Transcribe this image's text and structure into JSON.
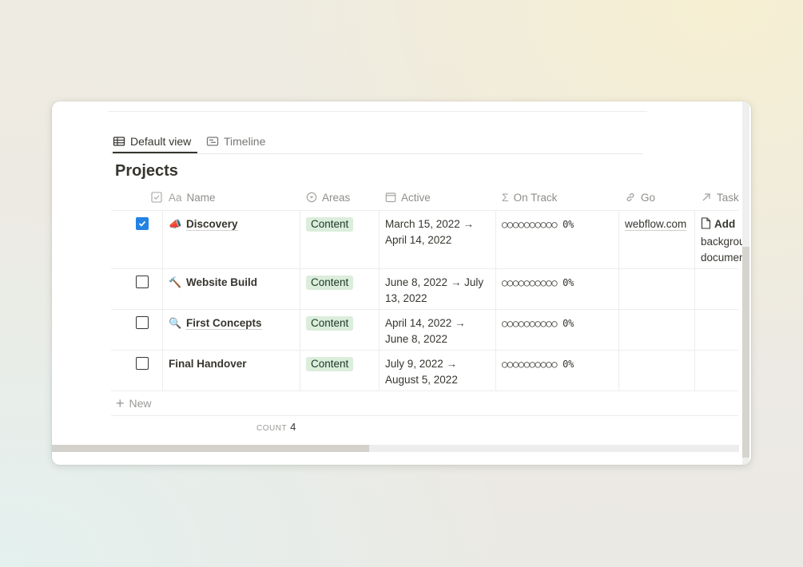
{
  "tabs": [
    {
      "label": "Default view",
      "icon": "table-icon"
    },
    {
      "label": "Timeline",
      "icon": "timeline-icon"
    }
  ],
  "database": {
    "title": "Projects"
  },
  "columns": {
    "check": {
      "icon": "checkbox-icon"
    },
    "name": {
      "label": "Name",
      "prefix": "Aa"
    },
    "areas": {
      "label": "Areas",
      "icon": "select-icon"
    },
    "active": {
      "label": "Active",
      "icon": "calendar-icon"
    },
    "track": {
      "label": "On Track",
      "icon": "sigma-icon"
    },
    "go": {
      "label": "Go",
      "icon": "link-icon"
    },
    "tasks": {
      "label": "Task",
      "icon": "arrow-up-right-icon"
    }
  },
  "rows": [
    {
      "checked": true,
      "icon": "📣",
      "name": "Discovery",
      "area": "Content",
      "active": "March 15, 2022 → April 14, 2022",
      "track": "○○○○○○○○○○ 0%",
      "go": "webflow.com",
      "task": "Add",
      "task_rest": "background document"
    },
    {
      "checked": false,
      "icon": "🔨",
      "name": "Website Build",
      "area": "Content",
      "active": "June 8, 2022 → July 13, 2022",
      "track": "○○○○○○○○○○ 0%",
      "go": "",
      "task": ""
    },
    {
      "checked": false,
      "icon": "🔍",
      "name": "First Concepts",
      "area": "Content",
      "active": "April 14, 2022 → June 8, 2022",
      "track": "○○○○○○○○○○ 0%",
      "go": "",
      "task": ""
    },
    {
      "checked": false,
      "icon": "",
      "name": "Final Handover",
      "area": "Content",
      "active": "July 9, 2022 → August 5, 2022",
      "track": "○○○○○○○○○○ 0%",
      "go": "",
      "task": ""
    }
  ],
  "new_label": "New",
  "footer": {
    "count_label": "COUNT",
    "count_value": "4"
  },
  "colors": {
    "accent": "#2383e2",
    "pill_bg": "#dbeddb",
    "pill_text": "#1c3829"
  }
}
